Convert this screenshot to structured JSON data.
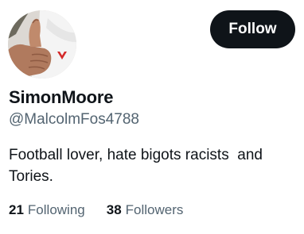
{
  "profile": {
    "display_name": "SimonMoore",
    "handle": "@MalcolmFos4788",
    "bio": "Football lover, hate bigots racists  and\nTories."
  },
  "actions": {
    "follow_label": "Follow"
  },
  "stats": {
    "following_count": "21",
    "following_label": "Following",
    "followers_count": "38",
    "followers_label": "Followers"
  },
  "colors": {
    "text_primary": "#0f1419",
    "text_secondary": "#536471",
    "button_bg": "#0f1419",
    "button_text": "#ffffff"
  },
  "icons": {
    "avatar": "thumbs-up-photo"
  }
}
